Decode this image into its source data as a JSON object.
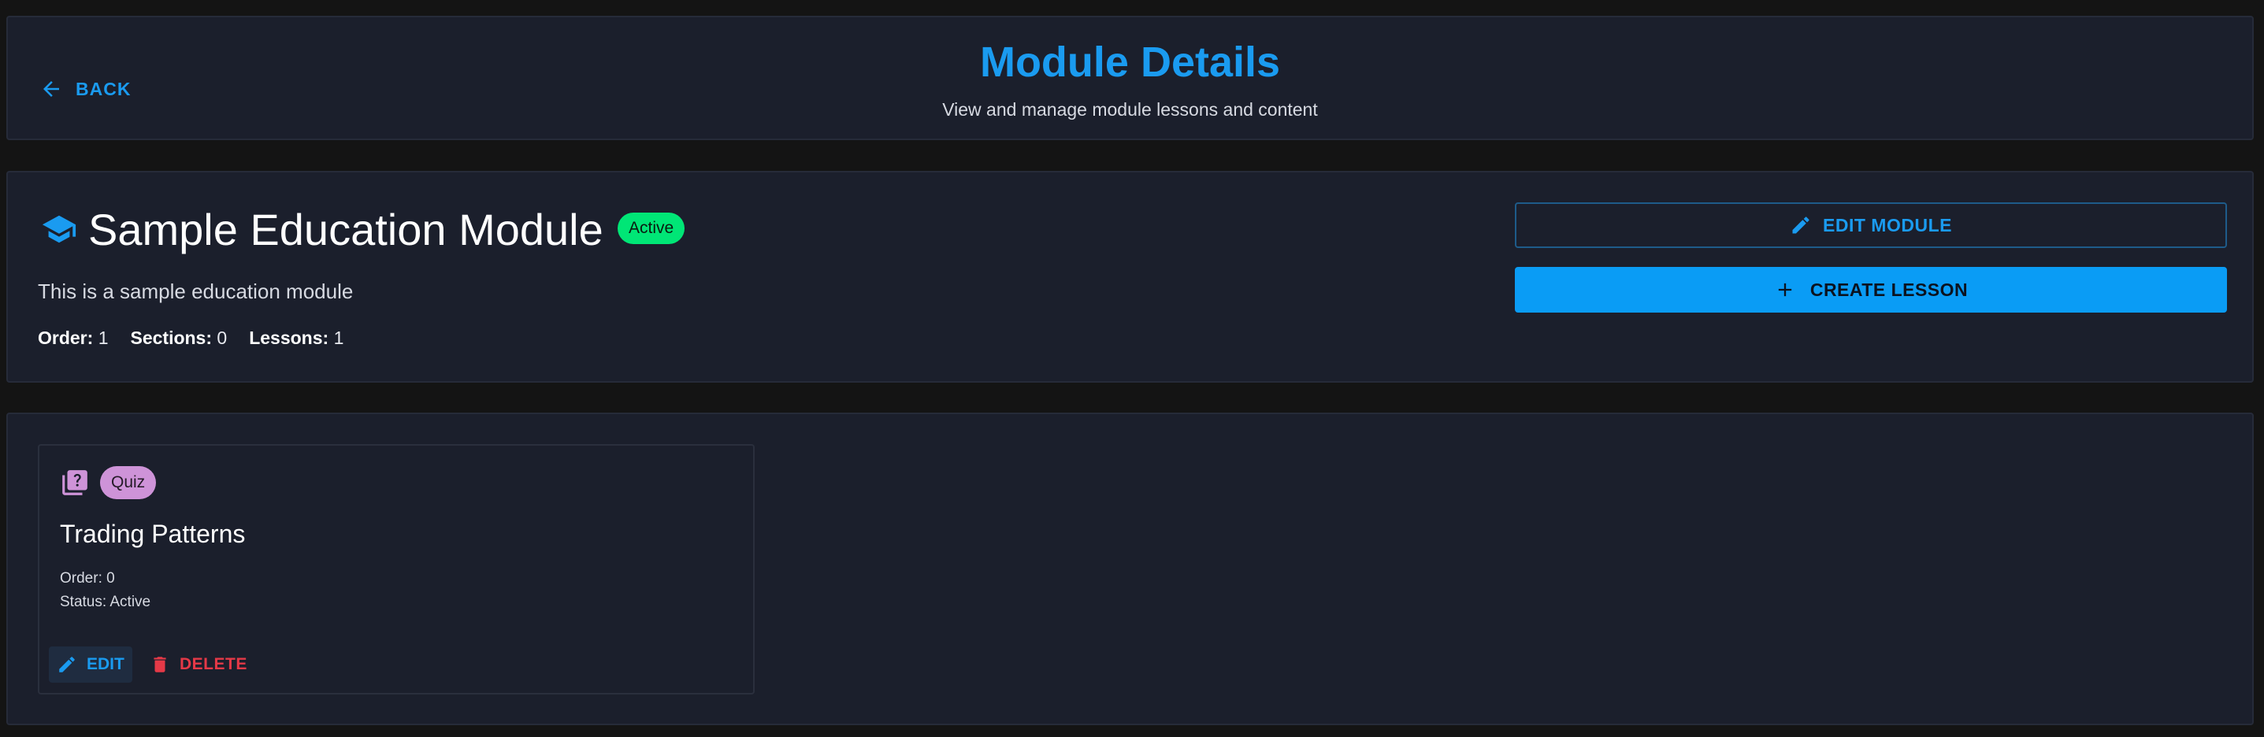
{
  "header": {
    "back_label": "BACK",
    "title": "Module Details",
    "subtitle": "View and manage module lessons and content"
  },
  "module": {
    "title": "Sample Education Module",
    "status": "Active",
    "description": "This is a sample education module",
    "meta": {
      "order_label": "Order:",
      "order_value": "1",
      "sections_label": "Sections:",
      "sections_value": "0",
      "lessons_label": "Lessons:",
      "lessons_value": "1"
    },
    "actions": {
      "edit_label": "EDIT MODULE",
      "create_label": "CREATE LESSON"
    }
  },
  "lessons": [
    {
      "type": "Quiz",
      "title": "Trading Patterns",
      "order": "Order: 0",
      "status": "Status: Active",
      "edit_label": "EDIT",
      "delete_label": "DELETE"
    }
  ],
  "colors": {
    "accent": "#1a9bf0",
    "primary_button": "#0a9cf5",
    "active_chip": "#00e676",
    "quiz_chip": "#ce93d8",
    "danger": "#e53947",
    "panel_bg": "#1b1f2c",
    "page_bg": "#141414"
  },
  "icons": {
    "back": "arrow-left-icon",
    "module": "graduation-cap-icon",
    "edit": "pencil-icon",
    "create": "plus-icon",
    "quiz": "quiz-library-icon",
    "delete": "trash-icon"
  }
}
